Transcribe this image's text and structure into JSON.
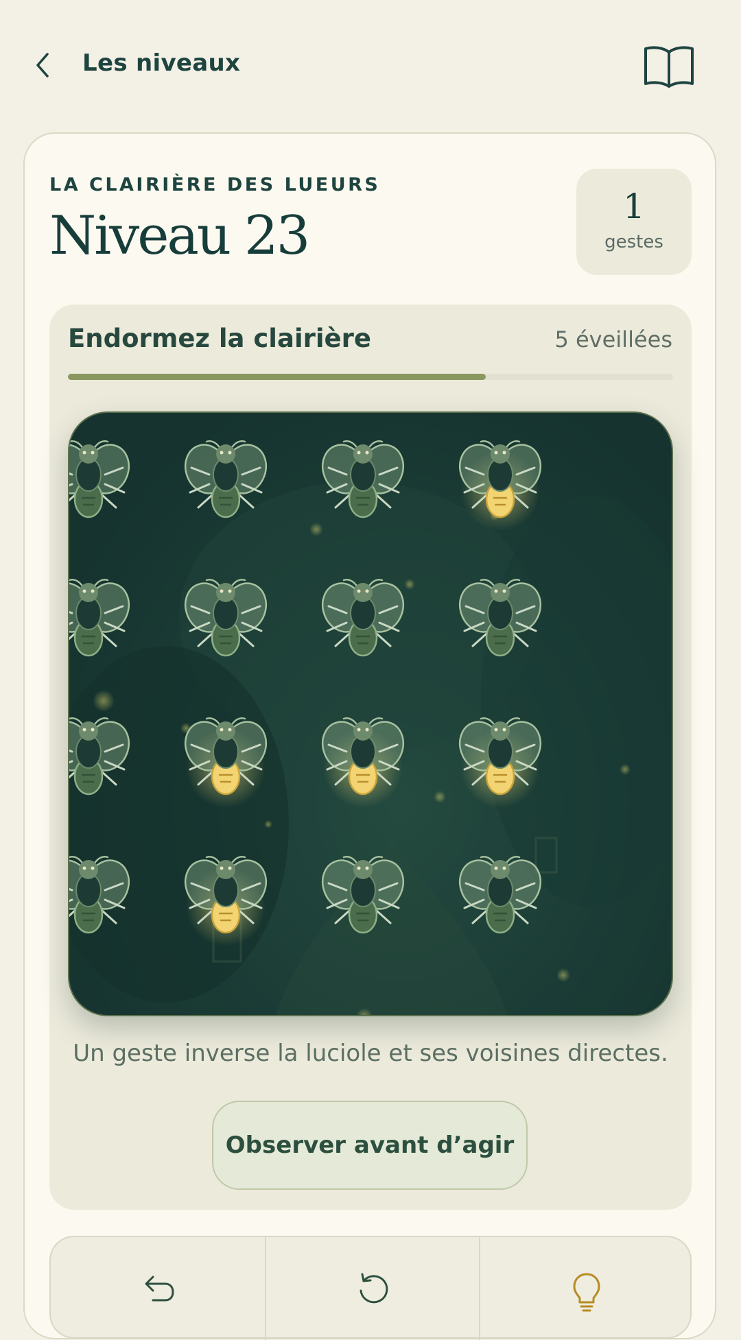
{
  "nav": {
    "back_label": "Les niveaux",
    "back_icon": "chevron-left-icon",
    "rules_icon": "book-icon"
  },
  "level": {
    "world": "LA CLAIRIÈRE DES LUEURS",
    "title": "Niveau 23",
    "moves_count": "1",
    "moves_label": "gestes"
  },
  "goal": {
    "text": "Endormez la clairière",
    "awake_text": "5 éveillées",
    "progress": 0.69
  },
  "board": {
    "rows": 4,
    "cols": 4,
    "lit": [
      [
        false,
        false,
        false,
        true
      ],
      [
        false,
        false,
        false,
        false
      ],
      [
        false,
        true,
        true,
        true
      ],
      [
        false,
        true,
        false,
        false
      ]
    ]
  },
  "hint": "Un geste inverse la luciole et ses voisines directes.",
  "observe_button": "Observer avant d’agir",
  "toolbar": {
    "undo_icon": "undo-icon",
    "restart_icon": "restart-icon",
    "hint_icon": "lightbulb-icon"
  },
  "colors": {
    "accent": "#8a9760",
    "board_bg": "#1a3a34",
    "firefly_lit": "#f2d572",
    "firefly_dark": "#4b6d4b"
  }
}
